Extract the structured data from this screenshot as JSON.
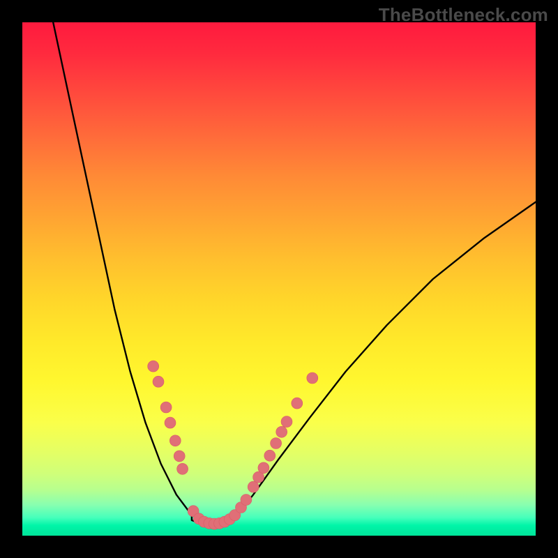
{
  "watermark": {
    "text": "TheBottleneck.com"
  },
  "colors": {
    "frame_bg": "#000000",
    "curve_stroke": "#000000",
    "marker_fill": "#e06f77",
    "marker_stroke": "#d95b66"
  },
  "chart_data": {
    "type": "line",
    "title": "",
    "xlabel": "",
    "ylabel": "",
    "xlim": [
      0,
      100
    ],
    "ylim": [
      0,
      100
    ],
    "note": "Axes are unlabeled; values are estimates in 0–100 plot-coordinate space (y=0 at bottom, y=100 at top).",
    "series": [
      {
        "name": "bottleneck-curve-left",
        "x": [
          6,
          9,
          12,
          15,
          18,
          21,
          24,
          27,
          30,
          33
        ],
        "y": [
          100,
          86,
          72,
          58,
          44,
          32,
          22,
          14,
          8,
          4
        ]
      },
      {
        "name": "bottleneck-curve-floor",
        "x": [
          33,
          35,
          37,
          39,
          41
        ],
        "y": [
          3,
          2.3,
          2.1,
          2.3,
          3
        ]
      },
      {
        "name": "bottleneck-curve-right",
        "x": [
          41,
          45,
          50,
          56,
          63,
          71,
          80,
          90,
          100
        ],
        "y": [
          3,
          8,
          15,
          23,
          32,
          41,
          50,
          58,
          65
        ]
      }
    ],
    "markers": {
      "name": "highlight-points",
      "color": "#e06f77",
      "radius": 8,
      "points": [
        {
          "x": 25.5,
          "y": 33
        },
        {
          "x": 26.5,
          "y": 30
        },
        {
          "x": 28,
          "y": 25
        },
        {
          "x": 28.8,
          "y": 22
        },
        {
          "x": 29.8,
          "y": 18.5
        },
        {
          "x": 30.6,
          "y": 15.5
        },
        {
          "x": 31.2,
          "y": 13
        },
        {
          "x": 33.3,
          "y": 4.8
        },
        {
          "x": 34.4,
          "y": 3.3
        },
        {
          "x": 35.4,
          "y": 2.7
        },
        {
          "x": 36.4,
          "y": 2.4
        },
        {
          "x": 37.4,
          "y": 2.3
        },
        {
          "x": 38.4,
          "y": 2.4
        },
        {
          "x": 39.4,
          "y": 2.7
        },
        {
          "x": 40.4,
          "y": 3.2
        },
        {
          "x": 41.4,
          "y": 4.0
        },
        {
          "x": 42.6,
          "y": 5.5
        },
        {
          "x": 43.6,
          "y": 7.0
        },
        {
          "x": 45.0,
          "y": 9.5
        },
        {
          "x": 46.0,
          "y": 11.4
        },
        {
          "x": 47.0,
          "y": 13.2
        },
        {
          "x": 48.2,
          "y": 15.6
        },
        {
          "x": 49.4,
          "y": 18.0
        },
        {
          "x": 50.5,
          "y": 20.2
        },
        {
          "x": 51.5,
          "y": 22.2
        },
        {
          "x": 53.5,
          "y": 25.8
        },
        {
          "x": 56.5,
          "y": 30.7
        }
      ]
    }
  }
}
